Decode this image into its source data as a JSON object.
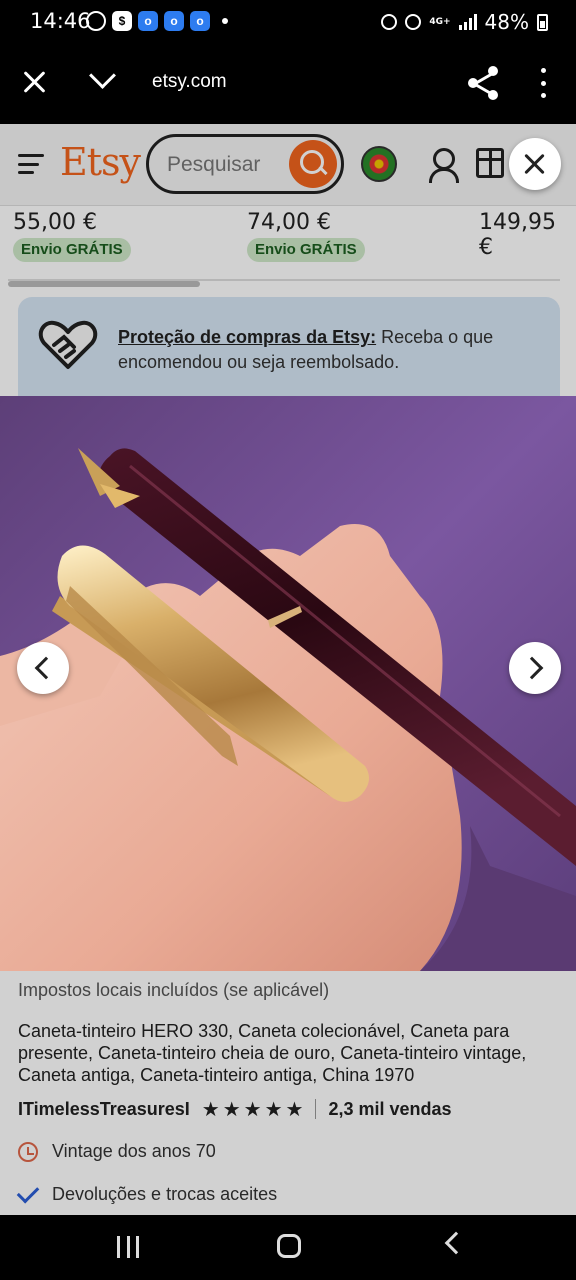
{
  "status_bar": {
    "time": "14:46",
    "network": "4G+",
    "battery": "48%"
  },
  "browser": {
    "url": "etsy.com"
  },
  "header": {
    "logo": "Etsy",
    "search_placeholder": "Pesquisar",
    "accent_color": "#f1641e"
  },
  "carousel_items": [
    {
      "price": "55,00 €",
      "shipping": "Envio GRÁTIS"
    },
    {
      "price": "74,00 €",
      "shipping": "Envio GRÁTIS"
    },
    {
      "price": "149,95 €"
    }
  ],
  "protection_banner": {
    "link_text": "Proteção de compras da Etsy:",
    "text": " Receba o que encomendou ou seja reembolsado."
  },
  "listing": {
    "tax_note": "Impostos locais incluídos (se aplicável)",
    "title": "Caneta-tinteiro HERO 330, Caneta colecionável, Caneta para presente, Caneta-tinteiro cheia de ouro, Caneta-tinteiro vintage, Caneta antiga, Caneta-tinteiro antiga, China 1970",
    "shop_name": "ITimelessTreasuresI",
    "rating": 5,
    "sales": "2,3 mil vendas",
    "features": [
      {
        "icon": "alarm-clock-icon",
        "text": "Vintage dos anos 70"
      },
      {
        "icon": "checkmark-icon",
        "text": "Devoluções e trocas aceites"
      }
    ]
  }
}
